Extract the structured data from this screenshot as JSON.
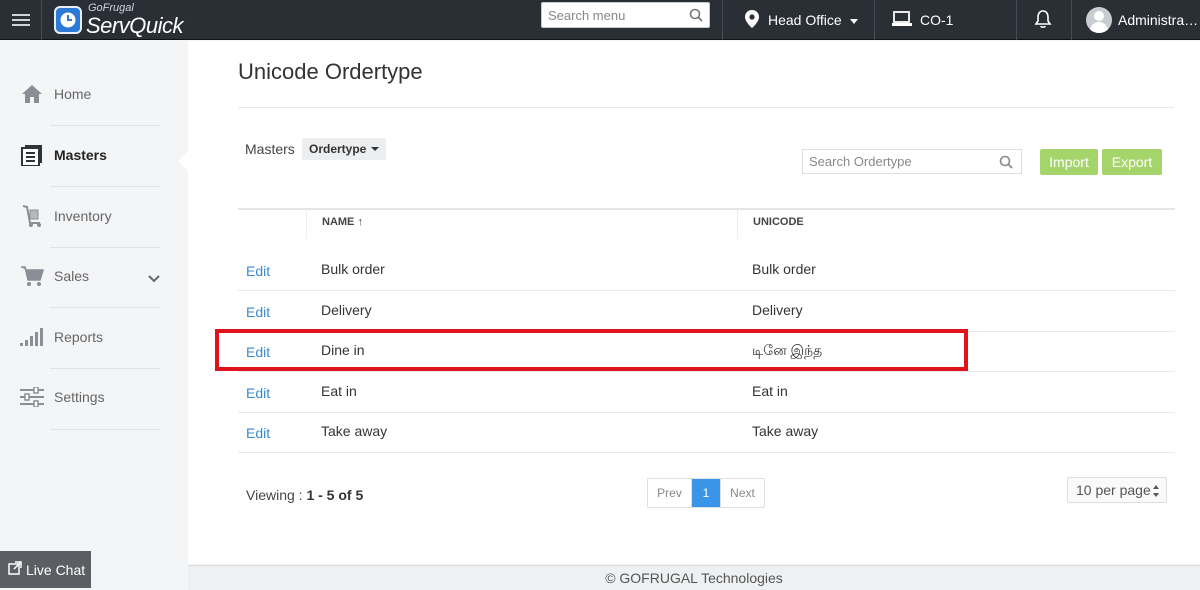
{
  "topbar": {
    "brand_small": "GoFrugal",
    "brand_big": "ServQuick",
    "search_placeholder": "Search menu",
    "location": "Head Office",
    "counter": "CO-1",
    "user": "Administra…"
  },
  "sidebar": {
    "items": [
      {
        "label": "Home",
        "icon": "home-icon"
      },
      {
        "label": "Masters",
        "icon": "masters-icon"
      },
      {
        "label": "Inventory",
        "icon": "inventory-icon"
      },
      {
        "label": "Sales",
        "icon": "cart-icon"
      },
      {
        "label": "Reports",
        "icon": "reports-icon"
      },
      {
        "label": "Settings",
        "icon": "settings-icon"
      }
    ],
    "active": "Masters",
    "livechat": "Live Chat"
  },
  "main": {
    "title": "Unicode Ordertype",
    "masters_label": "Masters",
    "ordertype_button": "Ordertype",
    "search_placeholder": "Search Ordertype",
    "import_label": "Import",
    "export_label": "Export",
    "columns": {
      "name": "NAME",
      "name_sort": "↑",
      "unicode": "UNICODE"
    },
    "rows": [
      {
        "action": "Edit",
        "name": "Bulk order",
        "unicode": "Bulk order"
      },
      {
        "action": "Edit",
        "name": "Delivery",
        "unicode": "Delivery"
      },
      {
        "action": "Edit",
        "name": "Dine in",
        "unicode": "டினே இந்த"
      },
      {
        "action": "Edit",
        "name": "Eat in",
        "unicode": "Eat in"
      },
      {
        "action": "Edit",
        "name": "Take away",
        "unicode": "Take away"
      }
    ],
    "viewing_label": "Viewing : ",
    "viewing_range": "1 - 5 of 5",
    "pager": {
      "prev": "Prev",
      "current": "1",
      "next": "Next"
    },
    "per_page": "10 per page"
  },
  "footer": "© GOFRUGAL Technologies",
  "colors": {
    "topbar": "#2a2f36",
    "accent_blue": "#3a95e8",
    "button_green": "#a5d46a",
    "highlight_red": "#e0121b"
  }
}
